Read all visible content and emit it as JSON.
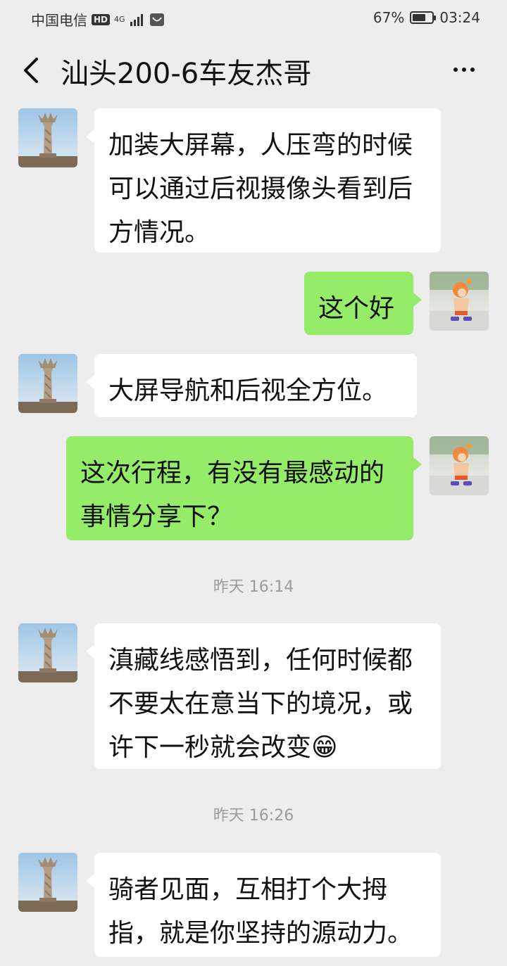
{
  "status_bar": {
    "carrier": "中国电信",
    "hd": "HD",
    "network": "4G",
    "battery_percent": "67%",
    "battery_level": 0.67,
    "time": "03:24"
  },
  "header": {
    "title": "汕头200-6车友杰哥"
  },
  "messages": [
    {
      "side": "in",
      "text": "加装大屏幕，人压弯的时候可以通过后视摄像头看到后方情况。"
    },
    {
      "side": "out",
      "text": "这个好"
    },
    {
      "side": "in",
      "text": "大屏导航和后视全方位。"
    },
    {
      "side": "out",
      "text": "这次行程，有没有最感动的事情分享下？"
    },
    {
      "side": "time",
      "text": "昨天 16:14"
    },
    {
      "side": "in",
      "text": "滇藏线感悟到，任何时候都不要太在意当下的境况，或许下一秒就会改变😁"
    },
    {
      "side": "time",
      "text": "昨天 16:26"
    },
    {
      "side": "in",
      "text": "骑者见面，互相打个大拇指，就是你坚持的源动力。"
    }
  ],
  "colors": {
    "background": "#ededed",
    "incoming_bubble": "#ffffff",
    "outgoing_bubble": "#95ec69"
  },
  "icons": {
    "back": "chevron-left-icon",
    "more": "more-dots-icon"
  }
}
